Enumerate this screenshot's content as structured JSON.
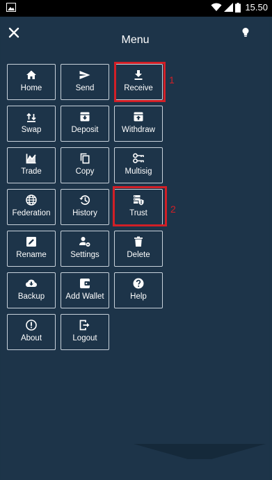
{
  "status_bar": {
    "time": "15.50",
    "icons": [
      "image-icon",
      "wifi-icon",
      "signal-icon",
      "battery-icon"
    ]
  },
  "header": {
    "title": "Menu",
    "close_icon": "close-icon",
    "bulb_icon": "lightbulb-icon"
  },
  "menu": {
    "items": [
      {
        "label": "Home",
        "icon": "home-icon"
      },
      {
        "label": "Send",
        "icon": "send-icon"
      },
      {
        "label": "Receive",
        "icon": "download-icon"
      },
      {
        "label": "Swap",
        "icon": "swap-icon"
      },
      {
        "label": "Deposit",
        "icon": "deposit-icon"
      },
      {
        "label": "Withdraw",
        "icon": "withdraw-icon"
      },
      {
        "label": "Trade",
        "icon": "chart-icon"
      },
      {
        "label": "Copy",
        "icon": "copy-icon"
      },
      {
        "label": "Multisig",
        "icon": "keys-icon"
      },
      {
        "label": "Federation",
        "icon": "globe-icon"
      },
      {
        "label": "History",
        "icon": "history-icon"
      },
      {
        "label": "Trust",
        "icon": "trust-icon"
      },
      {
        "label": "Rename",
        "icon": "edit-icon"
      },
      {
        "label": "Settings",
        "icon": "user-settings-icon"
      },
      {
        "label": "Delete",
        "icon": "trash-icon"
      },
      {
        "label": "Backup",
        "icon": "cloud-download-icon"
      },
      {
        "label": "Add Wallet",
        "icon": "wallet-icon"
      },
      {
        "label": "Help",
        "icon": "help-icon"
      },
      {
        "label": "About",
        "icon": "info-icon"
      },
      {
        "label": "Logout",
        "icon": "logout-icon"
      }
    ]
  },
  "annotations": [
    {
      "number": "1",
      "target": "Receive"
    },
    {
      "number": "2",
      "target": "Trust"
    }
  ],
  "colors": {
    "background": "#1d3449",
    "tile_border": "#c9d3dc",
    "text": "#ffffff",
    "annotation": "#d21f26"
  }
}
